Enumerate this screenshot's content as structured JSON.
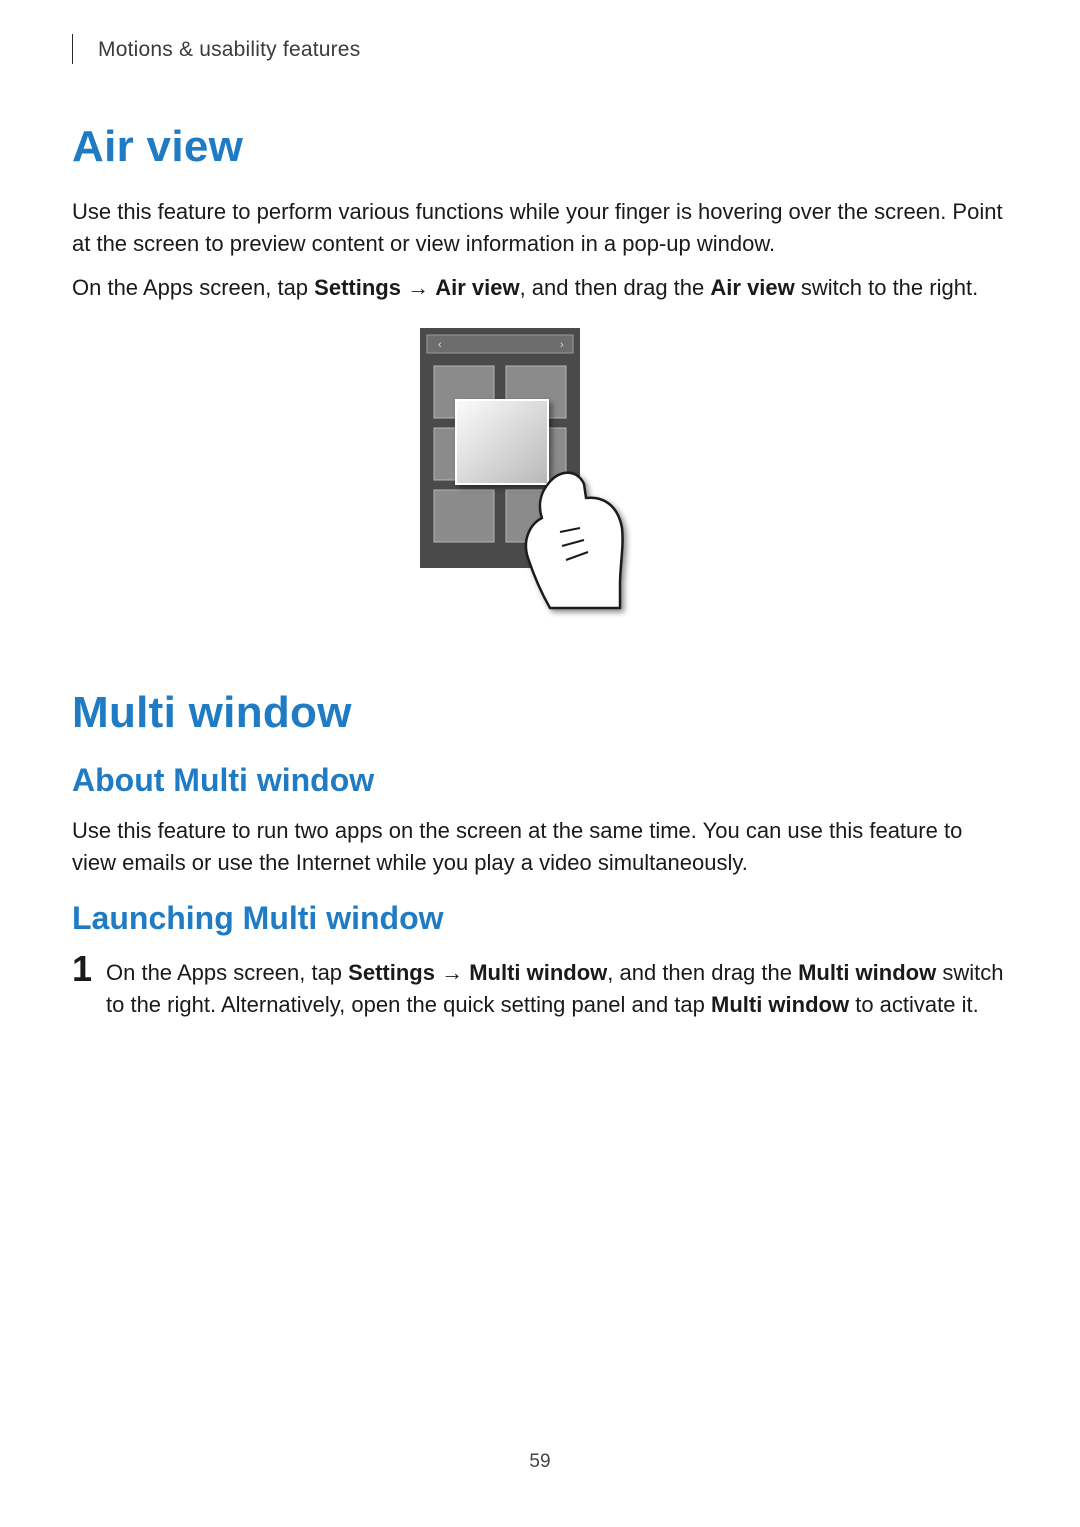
{
  "header": {
    "breadcrumb": "Motions & usability features"
  },
  "sections": {
    "airview": {
      "title": "Air view",
      "para1": "Use this feature to perform various functions while your finger is hovering over the screen. Point at the screen to preview content or view information in a pop-up window.",
      "para2_pre": "On the Apps screen, tap ",
      "para2_b1": "Settings",
      "para2_arrow": " → ",
      "para2_b2": "Air view",
      "para2_mid": ", and then drag the ",
      "para2_b3": "Air view",
      "para2_post": " switch to the right."
    },
    "multiwindow": {
      "title": "Multi window",
      "about_h": "About Multi window",
      "about_p": "Use this feature to run two apps on the screen at the same time. You can use this feature to view emails or use the Internet while you play a video simultaneously.",
      "launch_h": "Launching Multi window",
      "step1_num": "1",
      "step1_pre": "On the Apps screen, tap ",
      "step1_b1": "Settings",
      "step1_arrow": " → ",
      "step1_b2": "Multi window",
      "step1_mid": ", and then drag the ",
      "step1_b3": "Multi window",
      "step1_mid2": " switch to the right. Alternatively, open the quick setting panel and tap ",
      "step1_b4": "Multi window",
      "step1_post": " to activate it."
    }
  },
  "page_number": "59"
}
